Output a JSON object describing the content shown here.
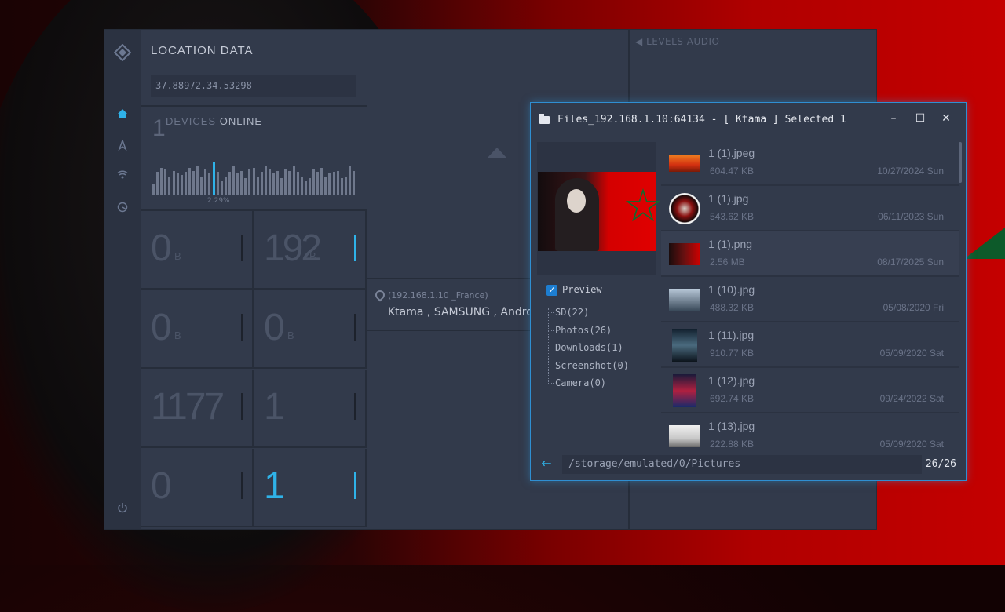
{
  "location": {
    "title": "LOCATION DATA",
    "coords": "37.88972.34.53298"
  },
  "devices": {
    "count": "1",
    "label_a": "DEVICES",
    "label_b": "ONLINE",
    "percent": "2.29%"
  },
  "bar_heights": [
    0.35,
    0.75,
    0.9,
    0.85,
    0.6,
    0.8,
    0.7,
    0.65,
    0.75,
    0.9,
    0.8,
    0.95,
    0.6,
    0.85,
    0.7,
    1.1,
    0.75,
    0.45,
    0.6,
    0.75,
    0.95,
    0.7,
    0.8,
    0.55,
    0.85,
    0.9,
    0.6,
    0.75,
    0.95,
    0.85,
    0.7,
    0.8,
    0.55,
    0.85,
    0.8,
    0.95,
    0.75,
    0.6,
    0.45,
    0.55,
    0.85,
    0.75,
    0.9,
    0.6,
    0.7,
    0.75,
    0.8,
    0.55,
    0.6,
    0.95,
    0.8
  ],
  "stats": [
    {
      "value": "0",
      "unit": "B",
      "blue": false,
      "tick": false
    },
    {
      "value": "192",
      "unit": "B",
      "blue": false,
      "tick": true
    },
    {
      "value": "0",
      "unit": "B",
      "blue": false,
      "tick": false
    },
    {
      "value": "0",
      "unit": "B",
      "blue": false,
      "tick": false
    },
    {
      "value": "1177",
      "unit": "",
      "blue": false,
      "tick": false
    },
    {
      "value": "1",
      "unit": "",
      "blue": false,
      "tick": false
    },
    {
      "value": "0",
      "unit": "",
      "blue": false,
      "tick": false
    },
    {
      "value": "1",
      "unit": "",
      "blue": true,
      "tick": true
    }
  ],
  "device": {
    "ip": "(192.168.1.10 _France)",
    "name": "Ktama , SAMSUNG , Android"
  },
  "levels": {
    "label": "LEVELS AUDIO"
  },
  "file_window": {
    "title": "Files_192.168.1.10:64134 - [ Ktama ] Selected 1",
    "minimize": "–",
    "maximize": "☐",
    "close": "✕",
    "preview_label": "Preview",
    "tree": [
      "SD(22)",
      "Photos(26)",
      "Downloads(1)",
      "Screenshot(0)",
      "Camera(0)"
    ],
    "files": [
      {
        "name": "1 (1).jpeg",
        "size": "604.47 KB",
        "date": "10/27/2024 Sun"
      },
      {
        "name": "1 (1).jpg",
        "size": "543.62 KB",
        "date": "06/11/2023 Sun"
      },
      {
        "name": "1 (1).png",
        "size": "2.56 MB",
        "date": "08/17/2025 Sun"
      },
      {
        "name": "1 (10).jpg",
        "size": "488.32 KB",
        "date": "05/08/2020 Fri"
      },
      {
        "name": "1 (11).jpg",
        "size": "910.77 KB",
        "date": "05/09/2020 Sat"
      },
      {
        "name": "1 (12).jpg",
        "size": "692.74 KB",
        "date": "09/24/2022 Sat"
      },
      {
        "name": "1 (13).jpg",
        "size": "222.88 KB",
        "date": "05/09/2020 Sat"
      }
    ],
    "path": "/storage/emulated/0/Pictures",
    "count": "26/26"
  },
  "colors": {
    "accent": "#2fb2e8",
    "window_border": "#2f8fd2",
    "panel": "#323a4b"
  }
}
